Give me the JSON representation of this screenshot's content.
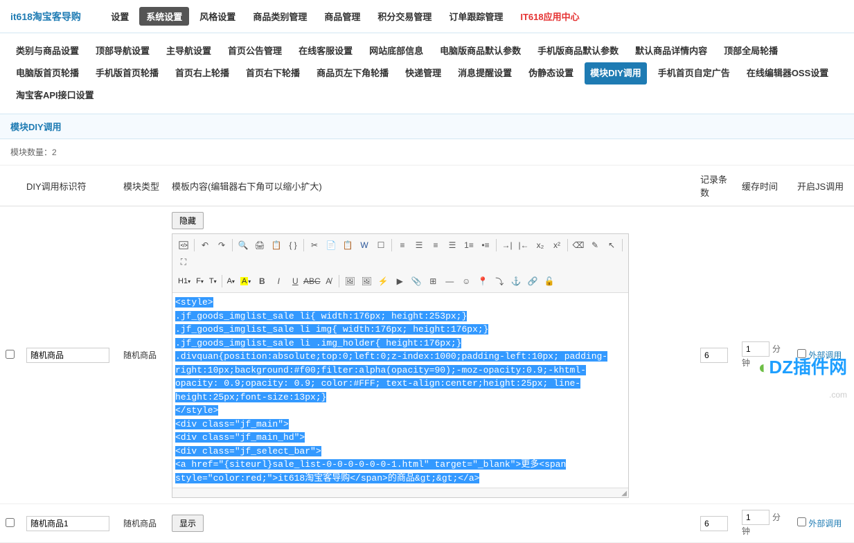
{
  "brand": "it618淘宝客导购",
  "topNav": {
    "items": [
      "设置",
      "系统设置",
      "风格设置",
      "商品类别管理",
      "商品管理",
      "积分交易管理",
      "订单跟踪管理",
      "IT618应用中心"
    ],
    "activeIndex": 1,
    "highlightIndex": 7
  },
  "subNav": {
    "items": [
      "类别与商品设置",
      "顶部导航设置",
      "主导航设置",
      "首页公告管理",
      "在线客服设置",
      "网站底部信息",
      "电脑版商品默认参数",
      "手机版商品默认参数",
      "默认商品详情内容",
      "顶部全局轮播",
      "电脑版首页轮播",
      "手机版首页轮播",
      "首页右上轮播",
      "首页右下轮播",
      "商品页左下角轮播",
      "快递管理",
      "消息提醒设置",
      "伪静态设置",
      "模块DIY调用",
      "手机首页自定广告",
      "在线编辑器OSS设置",
      "淘宝客API接口设置"
    ],
    "activeIndex": 18
  },
  "pageTitle": "模块DIY调用",
  "countLabel": "模块数量：",
  "countValue": "2",
  "columns": {
    "check": "",
    "id": "DIY调用标识符",
    "type": "模块类型",
    "content": "模板内容(编辑器右下角可以缩小扩大)",
    "records": "记录条数",
    "cache": "缓存时间",
    "jscall": "开启JS调用"
  },
  "rows": [
    {
      "id": "随机商品",
      "type": "随机商品",
      "toggleBtn": "隐藏",
      "records": "6",
      "cache": "1",
      "cacheUnit": "分钟",
      "extLink": "外部调用",
      "extChecked": false,
      "editorCode": "<style>\n.jf_goods_imglist_sale li{ width:176px; height:253px;}\n.jf_goods_imglist_sale li img{ width:176px; height:176px;}\n.jf_goods_imglist_sale li .img_holder{ height:176px;}\n.divquan{position:absolute;top:0;left:0;z-index:1000;padding-left:10px; padding-right:10px;background:#f00;filter:alpha(opacity=90);-moz-opacity:0.9;-khtml-opacity: 0.9;opacity: 0.9; color:#FFF; text-align:center;height:25px; line-height:25px;font-size:13px;}\n</style>\n<div class=\"jf_main\">\n        <div class=\"jf_main_hd\">\n            <div class=\"jf_select_bar\">\n                <a href=\"{siteurl}sale_list-0-0-0-0-0-0-1.html\" target=\"_blank\">更多<span style=\"color:red;\">it618淘宝客导购</span>的商品&gt;&gt;</a>"
    },
    {
      "id": "随机商品1",
      "type": "随机商品",
      "toggleBtn": "显示",
      "records": "6",
      "cache": "1",
      "cacheUnit": "分钟",
      "extLink": "外部调用",
      "extChecked": false
    }
  ],
  "toolbar": {
    "h1": "H1-",
    "font": "F-",
    "tt": "T-",
    "a": "A-"
  },
  "watermark": {
    "text": "DZ插件网",
    "sub": ".com"
  }
}
